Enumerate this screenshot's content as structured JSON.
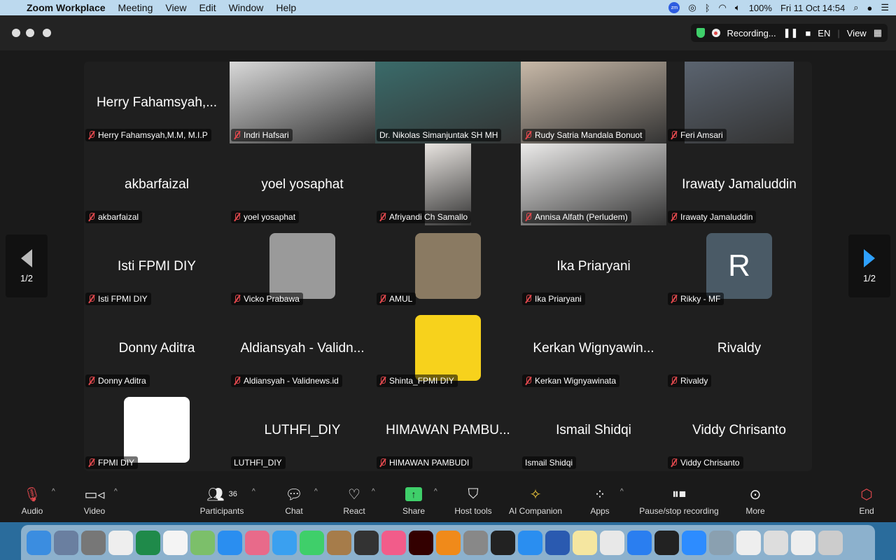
{
  "menubar": {
    "app": "Zoom Workplace",
    "items": [
      "Meeting",
      "View",
      "Edit",
      "Window",
      "Help"
    ],
    "battery": "100%",
    "datetime": "Fri 11 Oct  14:54"
  },
  "header": {
    "recording": "Recording...",
    "language": "EN",
    "view": "View"
  },
  "pagination": {
    "left": "1/2",
    "right": "1/2"
  },
  "tiles": [
    {
      "name": "Herry Fahamsyah,M.M, M.I.P",
      "big": "Herry Fahamsyah,...",
      "type": "name",
      "muted": true
    },
    {
      "name": "Indri Hafsari",
      "type": "video",
      "color": "#d9d9d9",
      "muted": true
    },
    {
      "name": "Dr. Nikolas Simanjuntak SH MH",
      "type": "video",
      "color": "#3a6b6a",
      "muted": false,
      "active": true
    },
    {
      "name": "Rudy Satria Mandala Bonuot",
      "type": "video",
      "color": "#c8b9a8",
      "muted": true
    },
    {
      "name": "Feri Amsari",
      "type": "narrow",
      "color": "#5b6470",
      "muted": true,
      "span": [
        26,
        182
      ]
    },
    {
      "name": "akbarfaizal",
      "big": "akbarfaizal",
      "type": "name",
      "muted": true
    },
    {
      "name": "yoel yosaphat",
      "big": "yoel yosaphat",
      "type": "name",
      "muted": true
    },
    {
      "name": "Afriyandi  Ch Samallo",
      "type": "narrow",
      "color": "#e8e4e0",
      "muted": true,
      "span": [
        71,
        137
      ]
    },
    {
      "name": "Annisa Alfath (Perludem)",
      "type": "video",
      "color": "#ecebea",
      "muted": true
    },
    {
      "name": "Irawaty Jamaluddin",
      "big": "Irawaty Jamaluddin",
      "type": "name",
      "muted": true
    },
    {
      "name": "Isti FPMI DIY",
      "big": "Isti FPMI DIY",
      "type": "name",
      "muted": true
    },
    {
      "name": "Vicko Prabawa",
      "type": "avatar",
      "color": "#9a9a9a",
      "muted": true
    },
    {
      "name": "AMUL",
      "type": "avatar",
      "color": "#8a7a62",
      "muted": true
    },
    {
      "name": "Ika Priaryani",
      "big": "Ika Priaryani",
      "type": "name",
      "muted": true
    },
    {
      "name": "Rikky - MF",
      "type": "letter",
      "letter": "R",
      "color": "#4a5a66",
      "muted": true
    },
    {
      "name": "Donny Aditra",
      "big": "Donny Aditra",
      "type": "name",
      "muted": true
    },
    {
      "name": "Aldiansyah - Validnews.id",
      "big": "Aldiansyah - Validn...",
      "type": "name",
      "muted": true
    },
    {
      "name": "Shinta_FPMI DIY",
      "type": "avatar",
      "color": "#f7d21c",
      "muted": true
    },
    {
      "name": "Kerkan Wignyawinata",
      "big": "Kerkan Wignyawin...",
      "type": "name",
      "muted": true
    },
    {
      "name": "Rivaldy",
      "big": "Rivaldy",
      "type": "name",
      "muted": true
    },
    {
      "name": "FPMI DIY",
      "type": "avatar",
      "color": "#ffffff",
      "muted": true
    },
    {
      "name": "LUTHFI_DIY",
      "big": "LUTHFI_DIY",
      "type": "name",
      "muted": false
    },
    {
      "name": "HIMAWAN PAMBUDI",
      "big": "HIMAWAN PAMBU...",
      "type": "name",
      "muted": true
    },
    {
      "name": "Ismail Shidqi",
      "big": "Ismail Shidqi",
      "type": "name",
      "muted": false
    },
    {
      "name": "Viddy Chrisanto",
      "big": "Viddy Chrisanto",
      "type": "name",
      "muted": true
    }
  ],
  "toolbar": {
    "audio": "Audio",
    "video": "Video",
    "participants": "Participants",
    "participant_count": "36",
    "chat": "Chat",
    "react": "React",
    "share": "Share",
    "host_tools": "Host tools",
    "ai_companion": "AI Companion",
    "apps": "Apps",
    "pause_stop": "Pause/stop recording",
    "more": "More",
    "end": "End"
  },
  "colors": {
    "active_speaker": "#3fc95c",
    "share": "#3fcf6a",
    "muted_mic": "#e0484d",
    "end": "#e0484d"
  }
}
